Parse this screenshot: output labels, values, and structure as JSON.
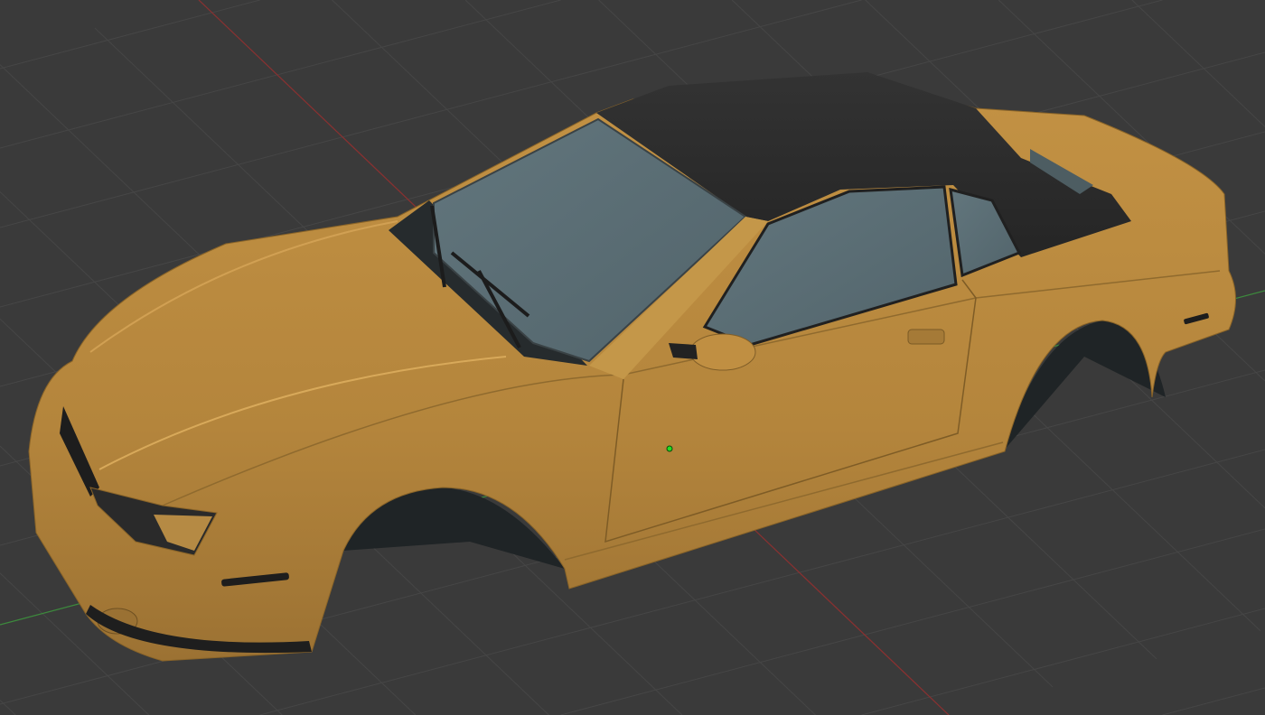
{
  "viewport": {
    "background_color": "#3a3a3a",
    "grid_color": "#464646",
    "x_axis_color": "#8a3030",
    "y_axis_color": "#3c8a3c",
    "origin_marker_color": "#22dd22"
  },
  "model": {
    "body_color": "#b98a40",
    "roof_color": "#2a2a2a",
    "glass_color": "#5a6d74",
    "wheel_well_color": "#1f2426"
  }
}
